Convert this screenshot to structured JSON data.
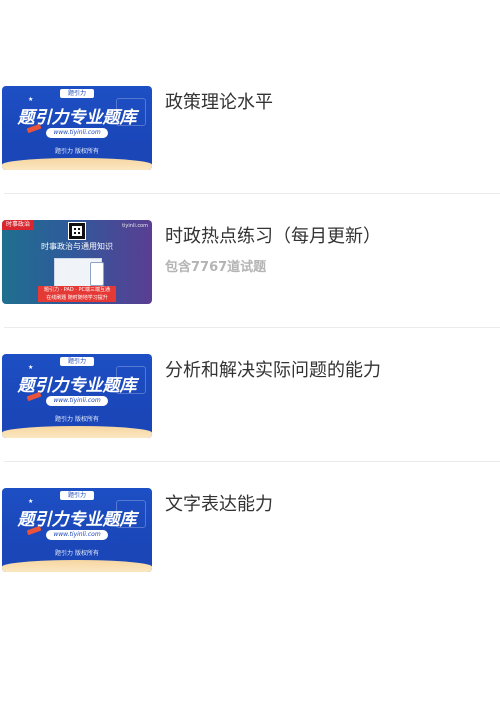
{
  "list": {
    "items": [
      {
        "title": "政策理论水平",
        "subtitle": "",
        "cover": {
          "type": "brand",
          "logo_text": "题引力",
          "headline": "题引力专业题库",
          "url_text": "www.tiyinli.com",
          "rights_text": "题引力 版权所有"
        }
      },
      {
        "title": "时政热点练习（每月更新）",
        "subtitle": "包含7767道试题",
        "cover": {
          "type": "current-affairs",
          "tag_text": "时事政治",
          "site_text": "tiyinli.com",
          "headline": "时事政治与通用知识",
          "box_line1": "题引力 · PAD · PC端三端互通",
          "box_line2": "在线刷题 随时随地学习提升"
        }
      },
      {
        "title": "分析和解决实际问题的能力",
        "subtitle": "",
        "cover": {
          "type": "brand",
          "logo_text": "题引力",
          "headline": "题引力专业题库",
          "url_text": "www.tiyinli.com",
          "rights_text": "题引力 版权所有"
        }
      },
      {
        "title": "文字表达能力",
        "subtitle": "",
        "cover": {
          "type": "brand",
          "logo_text": "题引力",
          "headline": "题引力专业题库",
          "url_text": "www.tiyinli.com",
          "rights_text": "题引力 版权所有"
        }
      }
    ]
  },
  "colors": {
    "brand_blue": "#1a46b8",
    "title_text": "#333333",
    "subtitle_text": "#b4b4b4",
    "divider": "#ececec"
  }
}
